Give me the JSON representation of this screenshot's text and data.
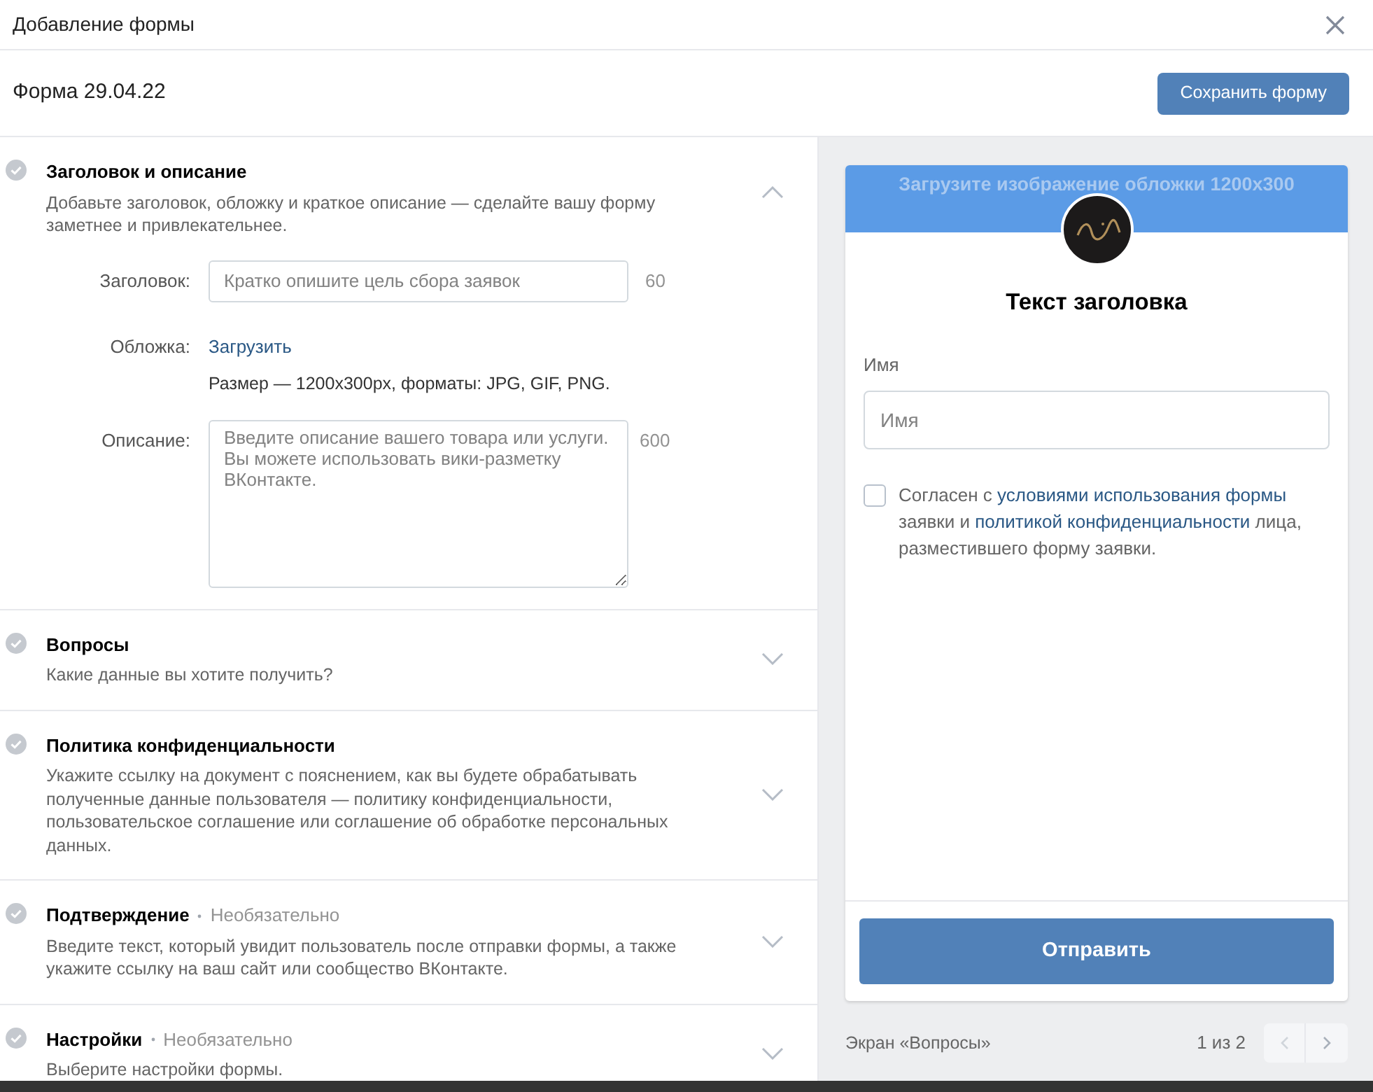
{
  "window": {
    "title": "Добавление формы"
  },
  "form_name": "Форма 29.04.22",
  "save_button": "Сохранить форму",
  "sections": [
    {
      "title": "Заголовок и описание",
      "description": "Добавьте заголовок, обложку и краткое описание — сделайте вашу форму заметнее и привлекательнее.",
      "expanded": true
    },
    {
      "title": "Вопросы",
      "description": "Какие данные вы хотите получить?",
      "expanded": false
    },
    {
      "title": "Политика конфиденциальности",
      "description": "Укажите ссылку на документ с пояснением, как вы будете обрабатывать полученные данные пользователя — политику конфиденциальности, пользовательское соглашение или соглашение об обработке персональных данных.",
      "expanded": false
    },
    {
      "title": "Подтверждение",
      "optional": "Необязательно",
      "description": "Введите текст, который увидит пользователь после отправки формы, а также укажите ссылку на ваш сайт или сообщество ВКонтакте.",
      "expanded": false
    },
    {
      "title": "Настройки",
      "optional": "Необязательно",
      "description": "Выберите настройки формы.",
      "expanded": false
    }
  ],
  "editor": {
    "title_label": "Заголовок:",
    "title_placeholder": "Кратко опишите цель сбора заявок",
    "title_limit": "60",
    "cover_label": "Обложка:",
    "cover_link": "Загрузить",
    "cover_hint": "Размер — 1200x300px, форматы: JPG, GIF, PNG.",
    "description_label": "Описание:",
    "description_placeholder": "Введите описание вашего товара или услуги.\nВы можете использовать вики-разметку\nВКонтакте.",
    "description_limit": "600"
  },
  "preview": {
    "cover_text": "Загрузите изображение обложки 1200x300",
    "heading": "Текст заголовка",
    "field_label": "Имя",
    "field_placeholder": "Имя",
    "consent": {
      "checked": false,
      "parts": [
        {
          "text": "Согласен с ",
          "link": false
        },
        {
          "text": "условиями использования формы",
          "link": true
        },
        {
          "text": " заявки и ",
          "link": false
        },
        {
          "text": "политикой конфиденциальности",
          "link": true
        },
        {
          "text": " лица, разместившего форму заявки.",
          "link": false
        }
      ]
    },
    "submit": "Отправить"
  },
  "footer": {
    "screen": "Экран «Вопросы»",
    "page": "1 из 2"
  }
}
